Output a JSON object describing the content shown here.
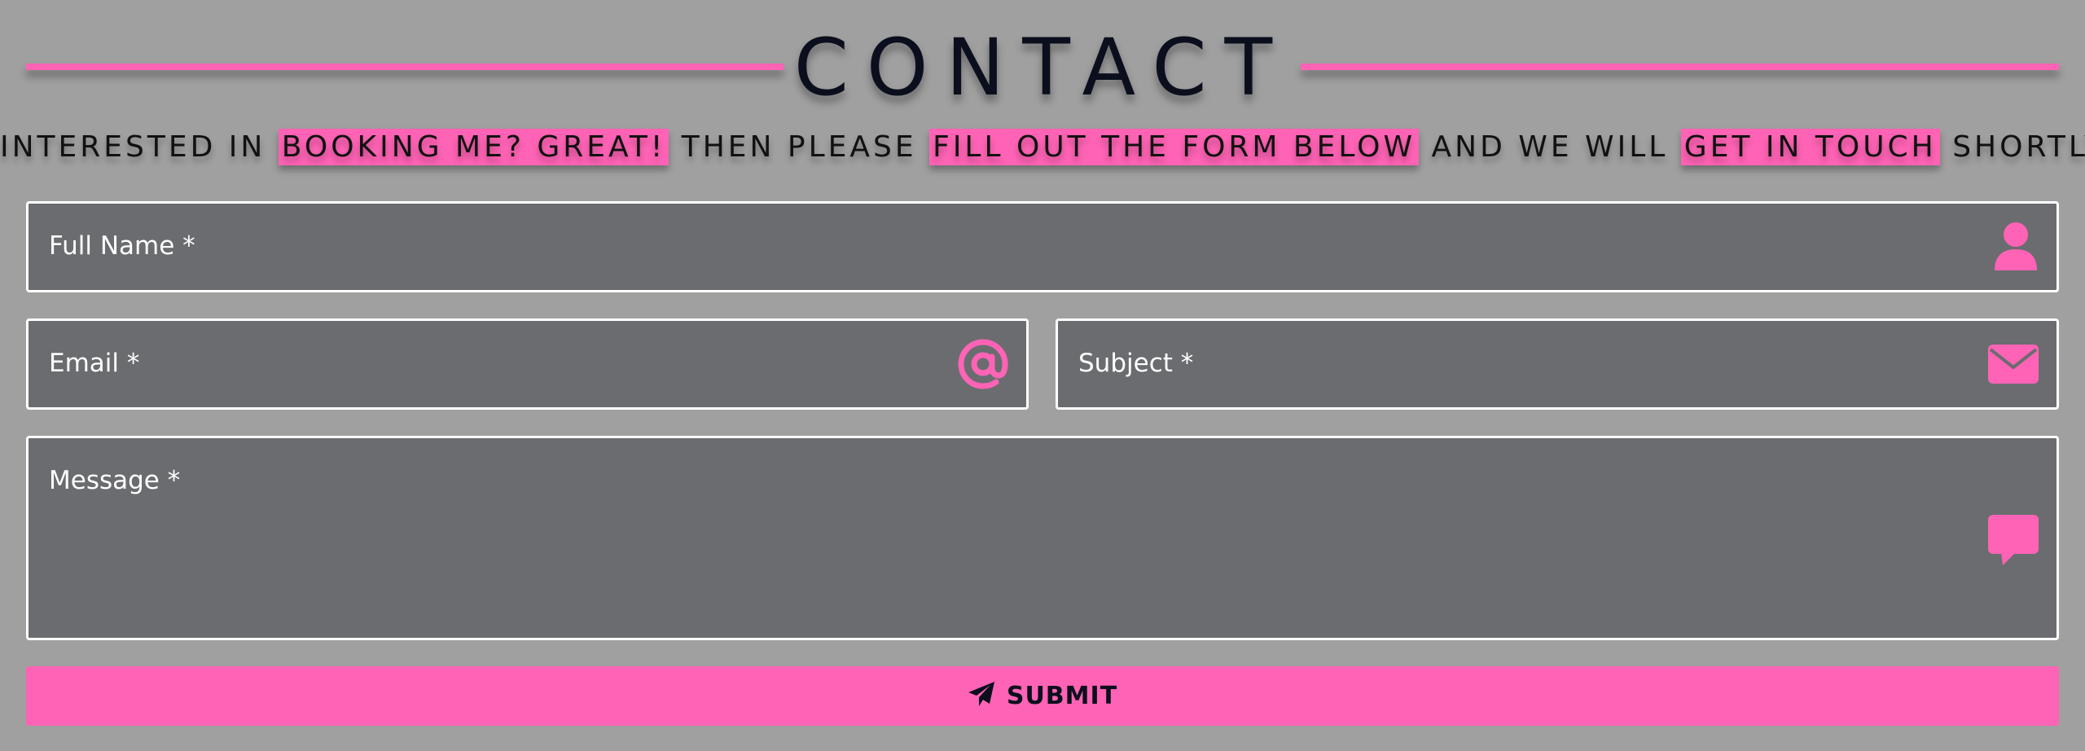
{
  "header": {
    "title": "CONTACT"
  },
  "tagline": {
    "part1": "INTERESTED IN ",
    "hl1": "BOOKING ME? GREAT!",
    "part2": " THEN PLEASE ",
    "hl2": "FILL OUT THE FORM BELOW",
    "part3": " AND WE WILL ",
    "hl3": "GET IN TOUCH",
    "part4": " SHORTLY"
  },
  "form": {
    "full_name": {
      "placeholder": "Full Name *",
      "icon": "user-icon"
    },
    "email": {
      "placeholder": "Email *",
      "icon": "at-icon"
    },
    "subject": {
      "placeholder": "Subject *",
      "icon": "envelope-icon"
    },
    "message": {
      "placeholder": "Message *",
      "icon": "comment-icon"
    },
    "submit": {
      "label": "SUBMIT",
      "icon": "paper-plane-icon"
    }
  },
  "colors": {
    "accent": "#ff63b5",
    "background": "#a0a0a0",
    "field_bg": "#6b6c70",
    "field_border": "#ffffff",
    "text_dark": "#0b0f1d"
  }
}
